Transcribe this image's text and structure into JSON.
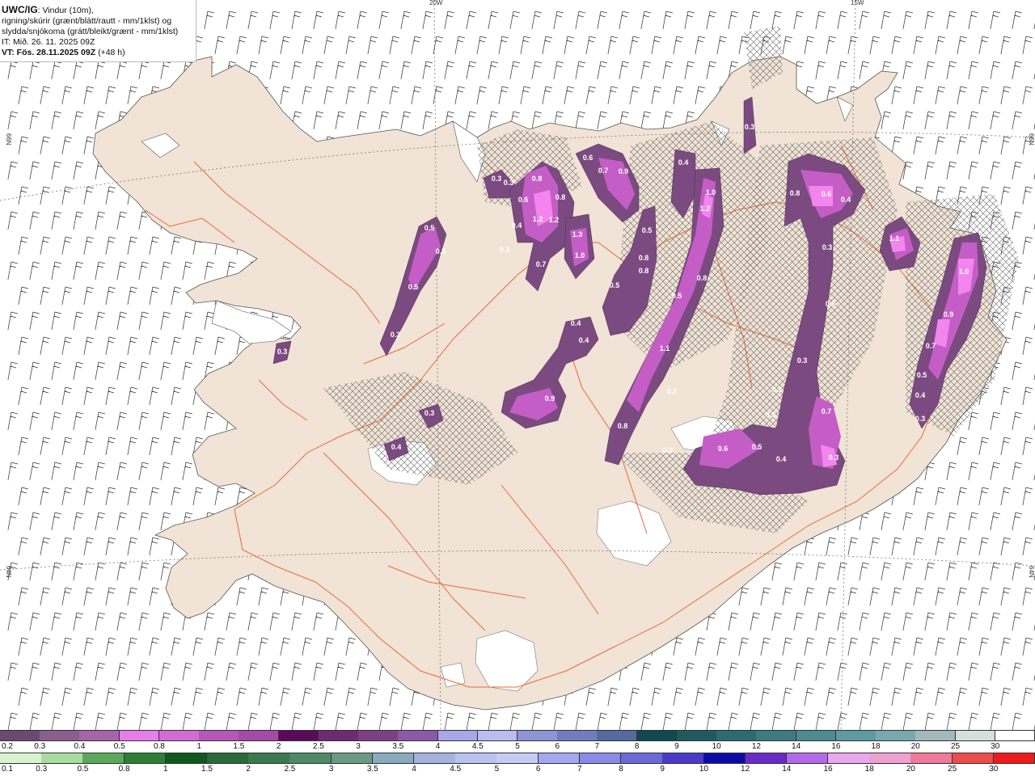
{
  "header": {
    "title": "UWC/IG",
    "desc1": ": Vindur (10m),",
    "desc2": "rigning/skúrir (grænt/blátt/rautt - mm/1klst) og",
    "desc3": "slydda/snjókoma (grátt/bleikt/grænt - mm/1klst)",
    "it_line": "IT: Mið. 26. 11. 2025 09Z",
    "vt_label": "VT: Fös. 28.11.2025 09Z",
    "vt_suffix": " (+48 h)"
  },
  "map": {
    "graticule_labels": [
      {
        "text": "20W"
      },
      {
        "text": "15W"
      },
      {
        "text": "66N"
      },
      {
        "text": "66N"
      },
      {
        "text": "64N"
      },
      {
        "text": "64N"
      }
    ],
    "colors": {
      "land": "#f1e3d5",
      "sea": "#ffffff",
      "roads": "#e86b3a",
      "precip_light": "#7b4a80",
      "precip_mid": "#c45ec6",
      "precip_heavy": "#f286ee",
      "barbs": "#333333"
    },
    "precip_labels": [
      {
        "text": "0.5"
      },
      {
        "text": "0.5"
      },
      {
        "text": "0.5"
      },
      {
        "text": "0.3"
      },
      {
        "text": "0.3"
      },
      {
        "text": "0.3"
      },
      {
        "text": "0.3"
      },
      {
        "text": "0.8"
      },
      {
        "text": "0.6"
      },
      {
        "text": "0.8"
      },
      {
        "text": "1.2"
      },
      {
        "text": "1.2"
      },
      {
        "text": "0.4"
      },
      {
        "text": "0.3"
      },
      {
        "text": "0.7"
      },
      {
        "text": "1.3"
      },
      {
        "text": "1.0"
      },
      {
        "text": "0.6"
      },
      {
        "text": "0.7"
      },
      {
        "text": "0.9"
      },
      {
        "text": "0.4"
      },
      {
        "text": "1.0"
      },
      {
        "text": "1.2"
      },
      {
        "text": "0.5"
      },
      {
        "text": "0.8"
      },
      {
        "text": "0.8"
      },
      {
        "text": "0.5"
      },
      {
        "text": "0.5"
      },
      {
        "text": "0.8"
      },
      {
        "text": "0.4"
      },
      {
        "text": "0.4"
      },
      {
        "text": "1.1"
      },
      {
        "text": "0.9"
      },
      {
        "text": "0.2"
      },
      {
        "text": "0.3"
      },
      {
        "text": "0.8"
      },
      {
        "text": "0.6"
      },
      {
        "text": "0.4"
      },
      {
        "text": "0.3"
      },
      {
        "text": "0.6"
      },
      {
        "text": "0.3"
      },
      {
        "text": "0.3"
      },
      {
        "text": "0.3"
      },
      {
        "text": "0.7"
      },
      {
        "text": "0.6"
      },
      {
        "text": "0.5"
      },
      {
        "text": "0.4"
      },
      {
        "text": "0.3"
      },
      {
        "text": "0.8"
      },
      {
        "text": "0.3"
      },
      {
        "text": "0.3"
      },
      {
        "text": "0.4"
      },
      {
        "text": "1.1"
      },
      {
        "text": "1.0"
      },
      {
        "text": "0.9"
      },
      {
        "text": "0.7"
      },
      {
        "text": "0.5"
      },
      {
        "text": "0.4"
      },
      {
        "text": "0.3"
      }
    ]
  },
  "legend_snow": {
    "labels": [
      "0.2",
      "0.3",
      "0.4",
      "0.5",
      "0.8",
      "1",
      "1.5",
      "2",
      "2.5",
      "3",
      "3.5",
      "4",
      "4.5",
      "5",
      "6",
      "7",
      "8",
      "9",
      "10",
      "12",
      "14",
      "16",
      "18",
      "20",
      "25",
      "30"
    ],
    "colors": [
      "#6b4a72",
      "#8a5e8f",
      "#a565a8",
      "#e77de9",
      "#d36bd5",
      "#b558b8",
      "#a54aa6",
      "#5a0a5a",
      "#6e2a72",
      "#7f3f85",
      "#8a5aa6",
      "#a9a6ea",
      "#bcbcf2",
      "#8e95d4",
      "#6f7dbf",
      "#556a9f",
      "#0f4a50",
      "#1f5a60",
      "#2e6a72",
      "#3e7a82",
      "#4e8a92",
      "#5e9aa2",
      "#78a8b0",
      "#a2b8bc",
      "#d6dede",
      "#ffffff"
    ]
  },
  "legend_rain": {
    "labels": [
      "0.1",
      "0.3",
      "0.5",
      "0.8",
      "1",
      "1.5",
      "2",
      "2.5",
      "3",
      "3.5",
      "4",
      "4.5",
      "5",
      "6",
      "7",
      "8",
      "9",
      "10",
      "12",
      "14",
      "16",
      "18",
      "20",
      "25",
      "30"
    ],
    "colors": [
      "#d8f5d0",
      "#a8dca0",
      "#5aa85a",
      "#2e7f36",
      "#0e5a1a",
      "#2a6a36",
      "#3a7a4e",
      "#4e8a66",
      "#6a9a86",
      "#8aaabe",
      "#a2b4de",
      "#b8c4ee",
      "#c6ccf6",
      "#a2a8f0",
      "#8a8ae8",
      "#6a6ad8",
      "#4a3ac8",
      "#0a0aa8",
      "#6a2ac8",
      "#b46ae8",
      "#e8a8f0",
      "#f0a0d0",
      "#f07a9a",
      "#f04a4a",
      "#ee1a1a"
    ]
  }
}
